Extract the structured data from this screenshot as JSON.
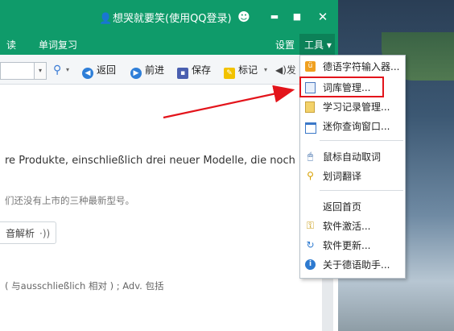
{
  "titlebar": {
    "user_label": "想哭就要笑(使用QQ登录)",
    "buttons": {
      "skin": "☻",
      "minimize": "▬",
      "maximize": "■",
      "close": "✕"
    }
  },
  "menubar": {
    "items": [
      "读",
      "单词复习"
    ],
    "settings": "设置",
    "tools": "工具 ▾"
  },
  "toolbar": {
    "search_icon": "⚲",
    "search_dropdown": "▾",
    "back": "返回",
    "forward": "前进",
    "save": "保存",
    "mark": "标记",
    "mark_dropdown": "▾",
    "sound_partial": "◀)发"
  },
  "content": {
    "sentence": "re Produkte, einschließlich drei neuer Modelle, die noch nicht",
    "translation": "们还没有上市的三种最新型号。",
    "analysis_button": "音解析",
    "analysis_icon": "·))",
    "grammar": "( 与ausschließlich 相对 ) ; Adv. 包括"
  },
  "tools_menu": {
    "items": [
      {
        "label": "德语字符输入器...",
        "icon": "input-method-icon"
      },
      {
        "label": "词库管理...",
        "icon": "dictionary-icon"
      },
      {
        "label": "学习记录管理...",
        "icon": "clipboard-icon"
      },
      {
        "label": "迷你查询窗口...",
        "icon": "window-icon"
      },
      {
        "label": "鼠标自动取词",
        "icon": "mouse-icon"
      },
      {
        "label": "划词翻译",
        "icon": "magnifier-icon"
      },
      {
        "label": "返回首页",
        "icon": ""
      },
      {
        "label": "软件激活...",
        "icon": "key-icon"
      },
      {
        "label": "软件更新...",
        "icon": "refresh-icon"
      },
      {
        "label": "关于德语助手...",
        "icon": "info-icon"
      }
    ]
  },
  "colors": {
    "title_green": "#0f9b6a",
    "highlight_red": "#e3141b"
  }
}
